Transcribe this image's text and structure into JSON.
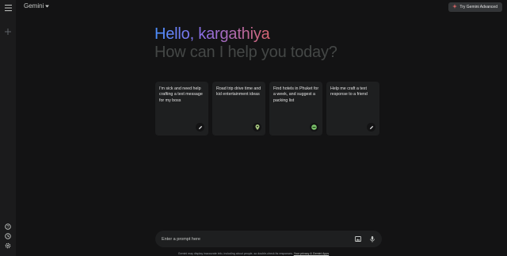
{
  "header": {
    "app_name": "Gemini",
    "advanced_button": "Try Gemini Advanced"
  },
  "greeting": {
    "hello": "Hello, kargathiya",
    "subtitle": "How can I help you today?"
  },
  "cards": [
    {
      "text": "I'm sick and need help crafting a text message for my boss",
      "icon": "edit-pencil-icon"
    },
    {
      "text": "Road trip drive time and kid entertainment ideas",
      "icon": "map-pin-icon"
    },
    {
      "text": "Find hotels in Phuket for a week, and suggest a packing list",
      "icon": "hotel-icon"
    },
    {
      "text": "Help me craft a text response to a friend",
      "icon": "edit-pencil-icon"
    }
  ],
  "prompt": {
    "placeholder": "Enter a prompt here"
  },
  "footer": {
    "disclaimer": "Gemini may display inaccurate info, including about people, so double-check its responses.",
    "link": "Your privacy & Gemini Apps"
  },
  "colors": {
    "background": "#131314",
    "card": "#1e1f20",
    "gradient_start": "#4b90ff",
    "gradient_end": "#d96570"
  }
}
